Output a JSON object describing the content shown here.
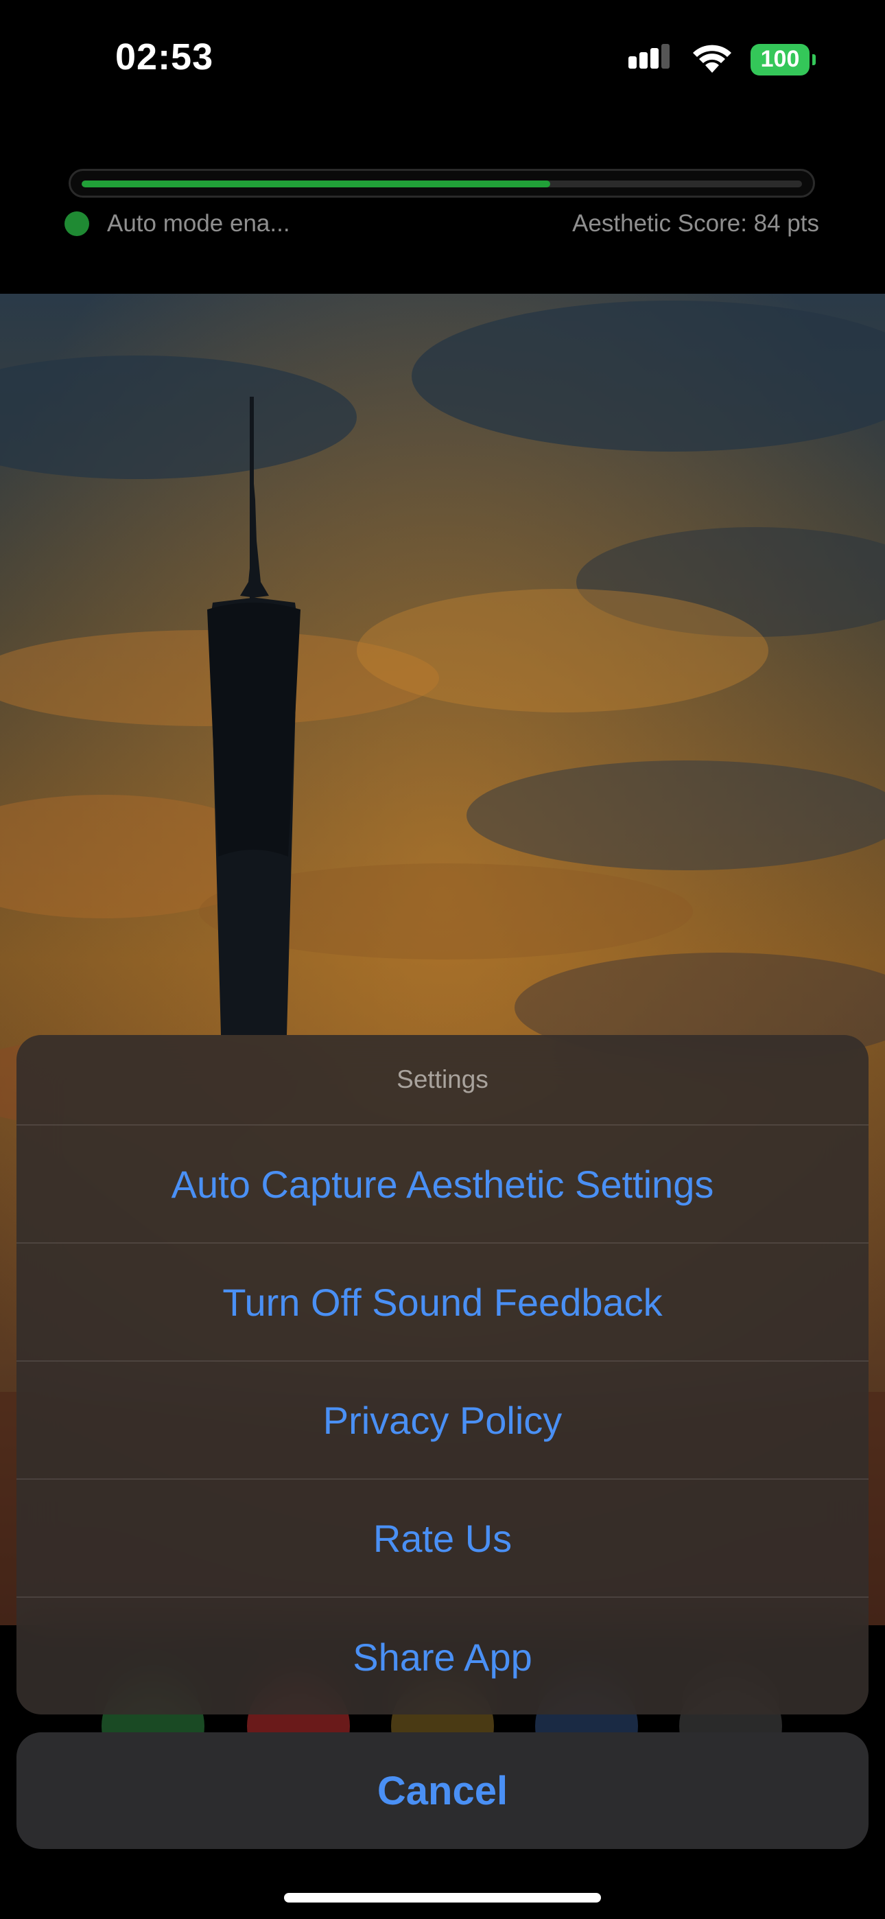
{
  "status_bar": {
    "time": "02:53",
    "battery": "100",
    "icons": [
      "signal-icon",
      "wifi-icon",
      "battery-icon"
    ]
  },
  "capture": {
    "progress": 0.65,
    "status_text": "Auto mode ena...",
    "score_text": "Aesthetic Score: 84 pts"
  },
  "action_sheet": {
    "title": "Settings",
    "items": [
      "Auto Capture Aesthetic Settings",
      "Turn Off Sound Feedback",
      "Privacy Policy",
      "Rate Us",
      "Share App"
    ],
    "cancel": "Cancel"
  },
  "colors": {
    "accent": "#4a90f5",
    "progress": "#21a038",
    "battery": "#34c759"
  }
}
